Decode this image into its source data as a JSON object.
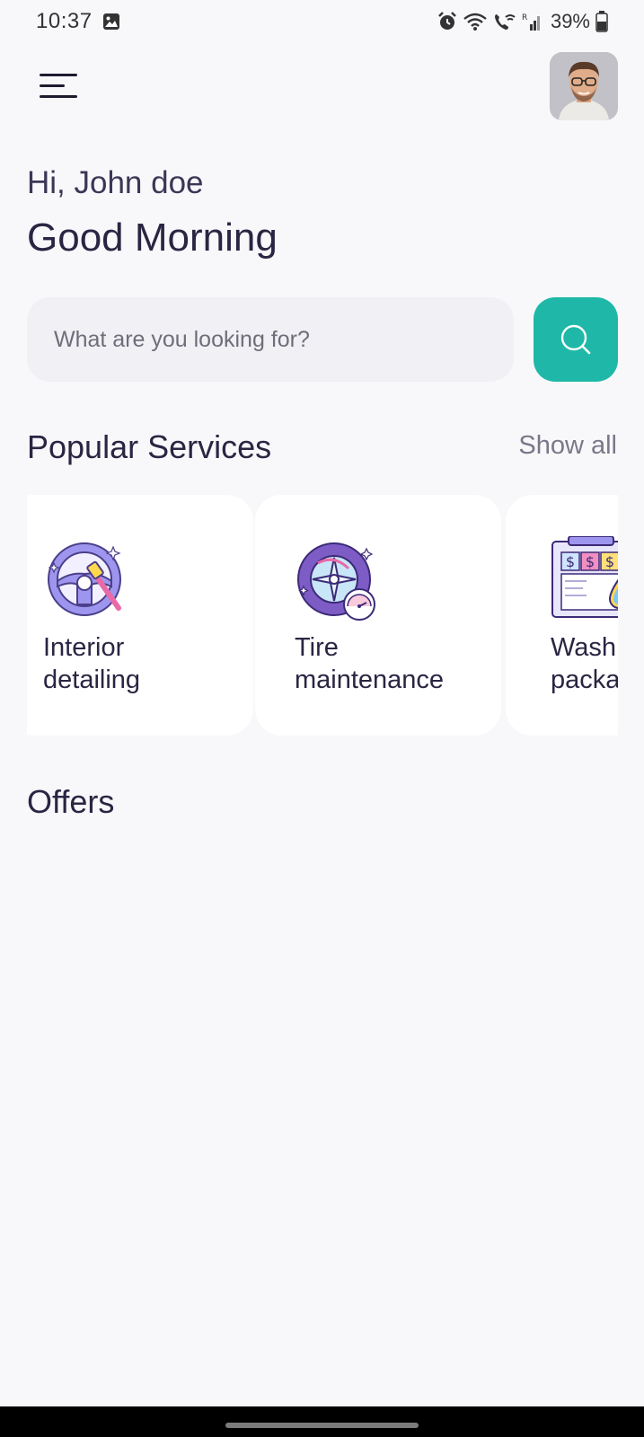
{
  "status_bar": {
    "time": "10:37",
    "battery": "39%",
    "icons": [
      "image-icon",
      "alarm-icon",
      "wifi-icon",
      "wifi-calling-icon",
      "signal-icon",
      "battery-icon"
    ]
  },
  "header": {
    "menu_icon": "hamburger-menu-icon",
    "avatar": "user-avatar"
  },
  "greeting": {
    "hi": "Hi, John doe",
    "headline": "Good Morning"
  },
  "search": {
    "placeholder": "What are you looking for?",
    "button_icon": "search-icon"
  },
  "popular_services": {
    "title": "Popular Services",
    "show_all": "Show all",
    "items": [
      {
        "label": "Interior\ndetailing",
        "icon": "steering-wheel-icon"
      },
      {
        "label": "Tire\nmaintenance",
        "icon": "tire-icon"
      },
      {
        "label": "Wash\npackages",
        "icon": "price-board-icon"
      }
    ]
  },
  "offers": {
    "title": "Offers"
  },
  "colors": {
    "accent": "#1fb8a8",
    "text_primary": "#2a2542",
    "background": "#f8f8fb",
    "card": "#ffffff",
    "icon_purple": "#8e83e6"
  }
}
